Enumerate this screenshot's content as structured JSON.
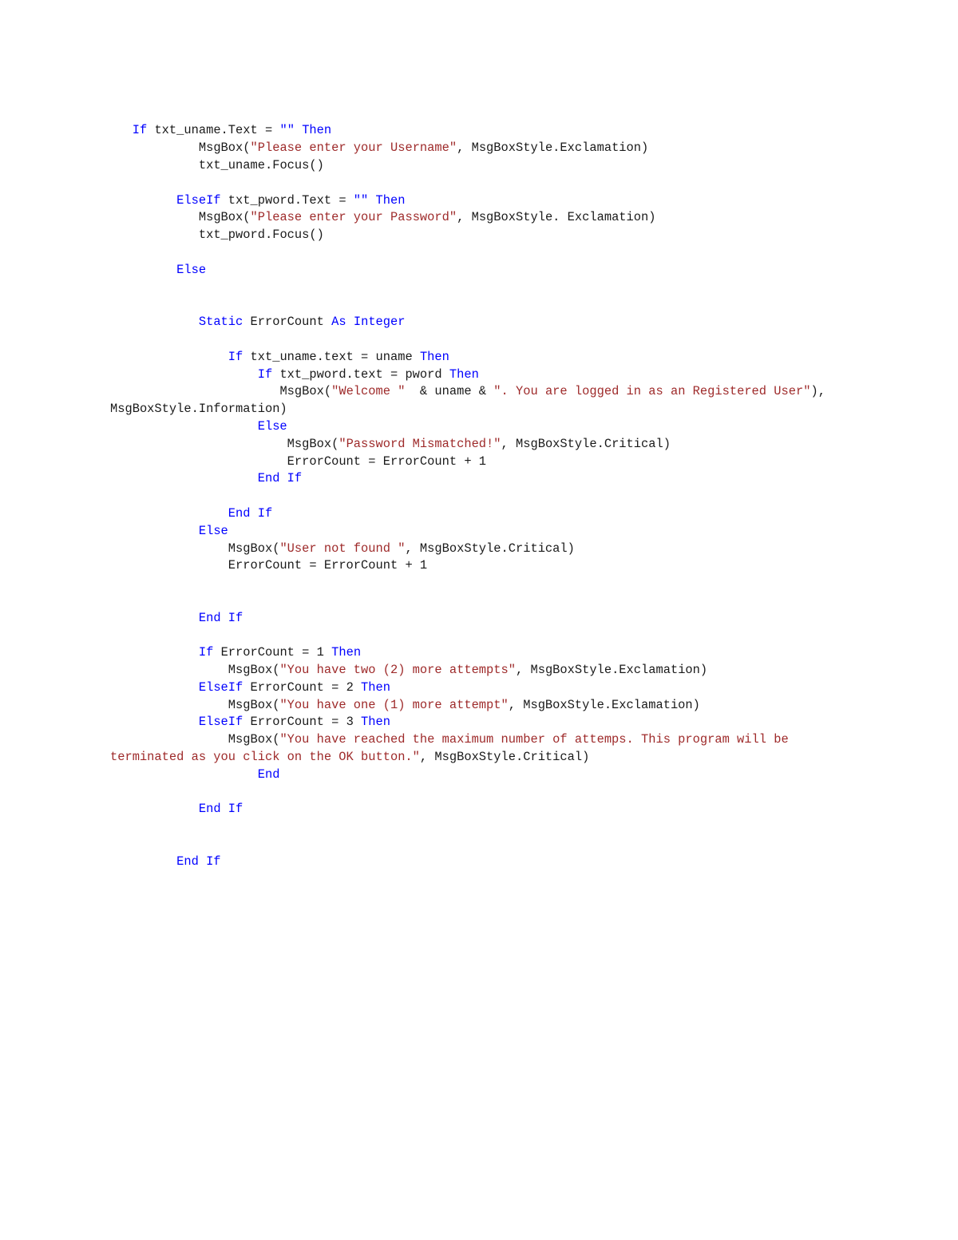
{
  "document": {
    "kind": "source-code-listing",
    "language": "Visual Basic .NET",
    "colors": {
      "keyword": "#0000FF",
      "string": "#9E2A2A",
      "identifier": "#1A1A1A",
      "background": "#FFFFFF"
    }
  },
  "code": {
    "lines": [
      {
        "indent": 3,
        "tokens": [
          {
            "t": "kw",
            "v": "If"
          },
          {
            "t": "id",
            "v": " txt_uname.Text = "
          },
          {
            "t": "kw",
            "v": "\"\""
          },
          {
            "t": "id",
            "v": " "
          },
          {
            "t": "kw",
            "v": "Then"
          }
        ]
      },
      {
        "indent": 12,
        "tokens": [
          {
            "t": "id",
            "v": "MsgBox("
          },
          {
            "t": "str",
            "v": "\"Please enter your Username\""
          },
          {
            "t": "id",
            "v": ", MsgBoxStyle.Exclamation)"
          }
        ]
      },
      {
        "indent": 12,
        "tokens": [
          {
            "t": "id",
            "v": "txt_uname.Focus()"
          }
        ]
      },
      {
        "indent": 0,
        "tokens": []
      },
      {
        "indent": 9,
        "tokens": [
          {
            "t": "kw",
            "v": "ElseIf"
          },
          {
            "t": "id",
            "v": " txt_pword.Text = "
          },
          {
            "t": "kw",
            "v": "\"\""
          },
          {
            "t": "id",
            "v": " "
          },
          {
            "t": "kw",
            "v": "Then"
          }
        ]
      },
      {
        "indent": 12,
        "tokens": [
          {
            "t": "id",
            "v": "MsgBox("
          },
          {
            "t": "str",
            "v": "\"Please enter your Password\""
          },
          {
            "t": "id",
            "v": ", MsgBoxStyle. Exclamation)"
          }
        ]
      },
      {
        "indent": 12,
        "tokens": [
          {
            "t": "id",
            "v": "txt_pword.Focus()"
          }
        ]
      },
      {
        "indent": 0,
        "tokens": []
      },
      {
        "indent": 9,
        "tokens": [
          {
            "t": "kw",
            "v": "Else"
          }
        ]
      },
      {
        "indent": 0,
        "tokens": []
      },
      {
        "indent": 0,
        "tokens": []
      },
      {
        "indent": 12,
        "tokens": [
          {
            "t": "kw",
            "v": "Static"
          },
          {
            "t": "id",
            "v": " ErrorCount "
          },
          {
            "t": "kw",
            "v": "As"
          },
          {
            "t": "id",
            "v": " "
          },
          {
            "t": "kw",
            "v": "Integer"
          }
        ]
      },
      {
        "indent": 0,
        "tokens": []
      },
      {
        "indent": 16,
        "tokens": [
          {
            "t": "kw",
            "v": "If"
          },
          {
            "t": "id",
            "v": " txt_uname.text = uname "
          },
          {
            "t": "kw",
            "v": "Then"
          }
        ]
      },
      {
        "indent": 20,
        "tokens": [
          {
            "t": "kw",
            "v": "If"
          },
          {
            "t": "id",
            "v": " txt_pword.text = pword "
          },
          {
            "t": "kw",
            "v": "Then"
          }
        ]
      },
      {
        "indent": 23,
        "tokens": [
          {
            "t": "id",
            "v": "MsgBox("
          },
          {
            "t": "str",
            "v": "\"Welcome \""
          },
          {
            "t": "id",
            "v": "  & uname & "
          },
          {
            "t": "str",
            "v": "\". You are logged in as an Registered User\""
          },
          {
            "t": "id",
            "v": "), MsgBoxStyle.Information)"
          }
        ]
      },
      {
        "indent": 20,
        "tokens": [
          {
            "t": "kw",
            "v": "Else"
          }
        ]
      },
      {
        "indent": 24,
        "tokens": [
          {
            "t": "id",
            "v": "MsgBox("
          },
          {
            "t": "str",
            "v": "\"Password Mismatched!\""
          },
          {
            "t": "id",
            "v": ", MsgBoxStyle.Critical)"
          }
        ]
      },
      {
        "indent": 24,
        "tokens": [
          {
            "t": "id",
            "v": "ErrorCount = ErrorCount + 1"
          }
        ]
      },
      {
        "indent": 20,
        "tokens": [
          {
            "t": "kw",
            "v": "End If"
          }
        ]
      },
      {
        "indent": 0,
        "tokens": []
      },
      {
        "indent": 16,
        "tokens": [
          {
            "t": "kw",
            "v": "End If"
          }
        ]
      },
      {
        "indent": 12,
        "tokens": [
          {
            "t": "kw",
            "v": "Else"
          }
        ]
      },
      {
        "indent": 16,
        "tokens": [
          {
            "t": "id",
            "v": "MsgBox("
          },
          {
            "t": "str",
            "v": "\"User not found \""
          },
          {
            "t": "id",
            "v": ", MsgBoxStyle.Critical)"
          }
        ]
      },
      {
        "indent": 16,
        "tokens": [
          {
            "t": "id",
            "v": "ErrorCount = ErrorCount + 1"
          }
        ]
      },
      {
        "indent": 0,
        "tokens": []
      },
      {
        "indent": 0,
        "tokens": []
      },
      {
        "indent": 12,
        "tokens": [
          {
            "t": "kw",
            "v": "End If"
          }
        ]
      },
      {
        "indent": 0,
        "tokens": []
      },
      {
        "indent": 12,
        "tokens": [
          {
            "t": "kw",
            "v": "If"
          },
          {
            "t": "id",
            "v": " ErrorCount = 1 "
          },
          {
            "t": "kw",
            "v": "Then"
          }
        ]
      },
      {
        "indent": 16,
        "tokens": [
          {
            "t": "id",
            "v": "MsgBox("
          },
          {
            "t": "str",
            "v": "\"You have two (2) more attempts\""
          },
          {
            "t": "id",
            "v": ", MsgBoxStyle.Exclamation)"
          }
        ]
      },
      {
        "indent": 12,
        "tokens": [
          {
            "t": "kw",
            "v": "ElseIf"
          },
          {
            "t": "id",
            "v": " ErrorCount = 2 "
          },
          {
            "t": "kw",
            "v": "Then"
          }
        ]
      },
      {
        "indent": 16,
        "tokens": [
          {
            "t": "id",
            "v": "MsgBox("
          },
          {
            "t": "str",
            "v": "\"You have one (1) more attempt\""
          },
          {
            "t": "id",
            "v": ", MsgBoxStyle.Exclamation)"
          }
        ]
      },
      {
        "indent": 12,
        "tokens": [
          {
            "t": "kw",
            "v": "ElseIf"
          },
          {
            "t": "id",
            "v": " ErrorCount = 3 "
          },
          {
            "t": "kw",
            "v": "Then"
          }
        ]
      },
      {
        "indent": 16,
        "tokens": [
          {
            "t": "id",
            "v": "MsgBox("
          },
          {
            "t": "str",
            "v": "\"You have reached the maximum number of attemps. This program will be terminated as you click on the OK button.\""
          },
          {
            "t": "id",
            "v": ", MsgBoxStyle.Critical)"
          }
        ]
      },
      {
        "indent": 20,
        "tokens": [
          {
            "t": "kw",
            "v": "End"
          }
        ]
      },
      {
        "indent": 0,
        "tokens": []
      },
      {
        "indent": 12,
        "tokens": [
          {
            "t": "kw",
            "v": "End If"
          }
        ]
      },
      {
        "indent": 0,
        "tokens": []
      },
      {
        "indent": 0,
        "tokens": []
      },
      {
        "indent": 9,
        "tokens": [
          {
            "t": "kw",
            "v": "End If"
          }
        ]
      }
    ]
  }
}
